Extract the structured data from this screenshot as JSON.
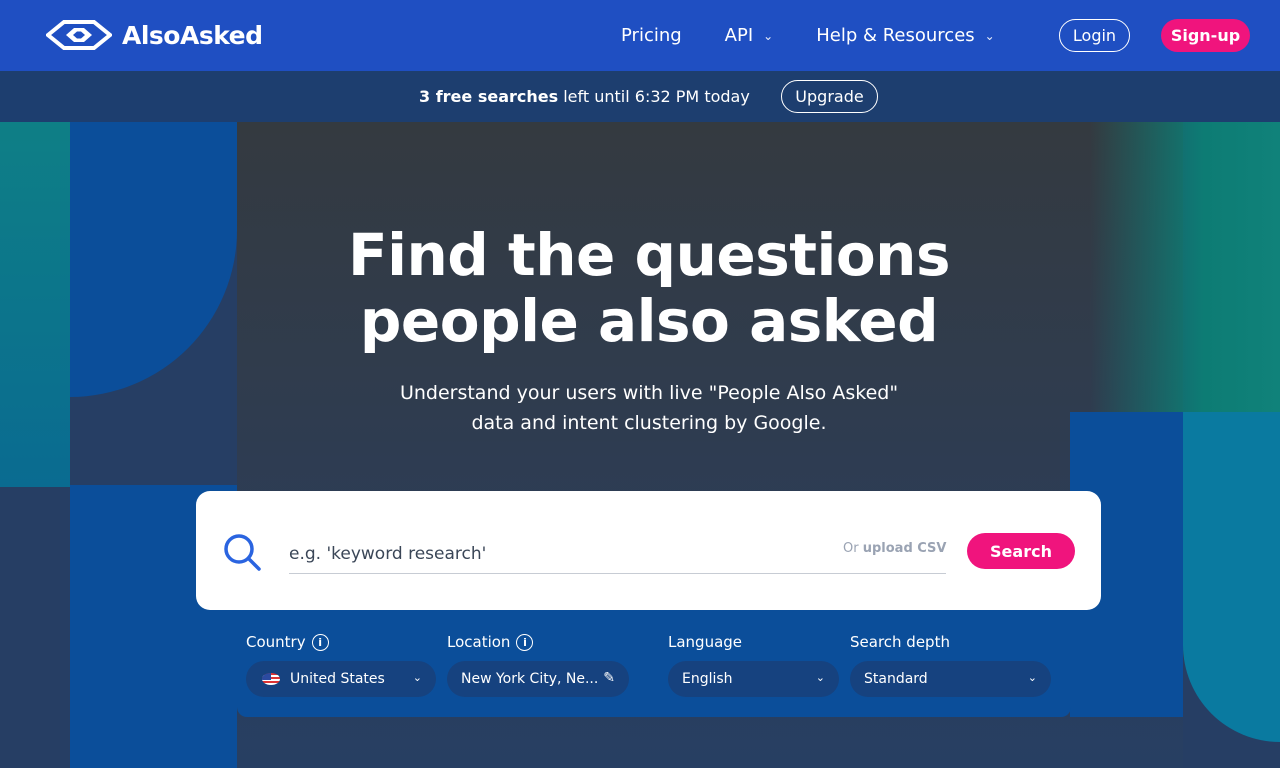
{
  "brand": {
    "name": "AlsoAsked"
  },
  "nav": {
    "links": [
      {
        "label": "Pricing",
        "has_dropdown": false
      },
      {
        "label": "API",
        "has_dropdown": true
      },
      {
        "label": "Help & Resources",
        "has_dropdown": true
      }
    ],
    "login_label": "Login",
    "signup_label": "Sign-up"
  },
  "banner": {
    "free_searches": "3 free searches",
    "rest": " left until 6:32 PM today",
    "upgrade_label": "Upgrade"
  },
  "hero": {
    "title_line1": "Find the questions",
    "title_line2": "people also asked",
    "subtitle_line1": "Understand your users with live \"People Also Asked\"",
    "subtitle_line2": "data and intent clustering by Google."
  },
  "search": {
    "placeholder": "e.g. 'keyword research'",
    "upload_or": "Or ",
    "upload_csv": "upload CSV",
    "button_label": "Search"
  },
  "options": {
    "country": {
      "label": "Country",
      "value": "United States"
    },
    "location": {
      "label": "Location",
      "value": "New York City, Ne..."
    },
    "language": {
      "label": "Language",
      "value": "English"
    },
    "depth": {
      "label": "Search depth",
      "value": "Standard"
    }
  },
  "colors": {
    "nav_bg": "#1f4fc2",
    "accent_pink": "#f0147d",
    "panel_blue": "#0b4e9a"
  }
}
